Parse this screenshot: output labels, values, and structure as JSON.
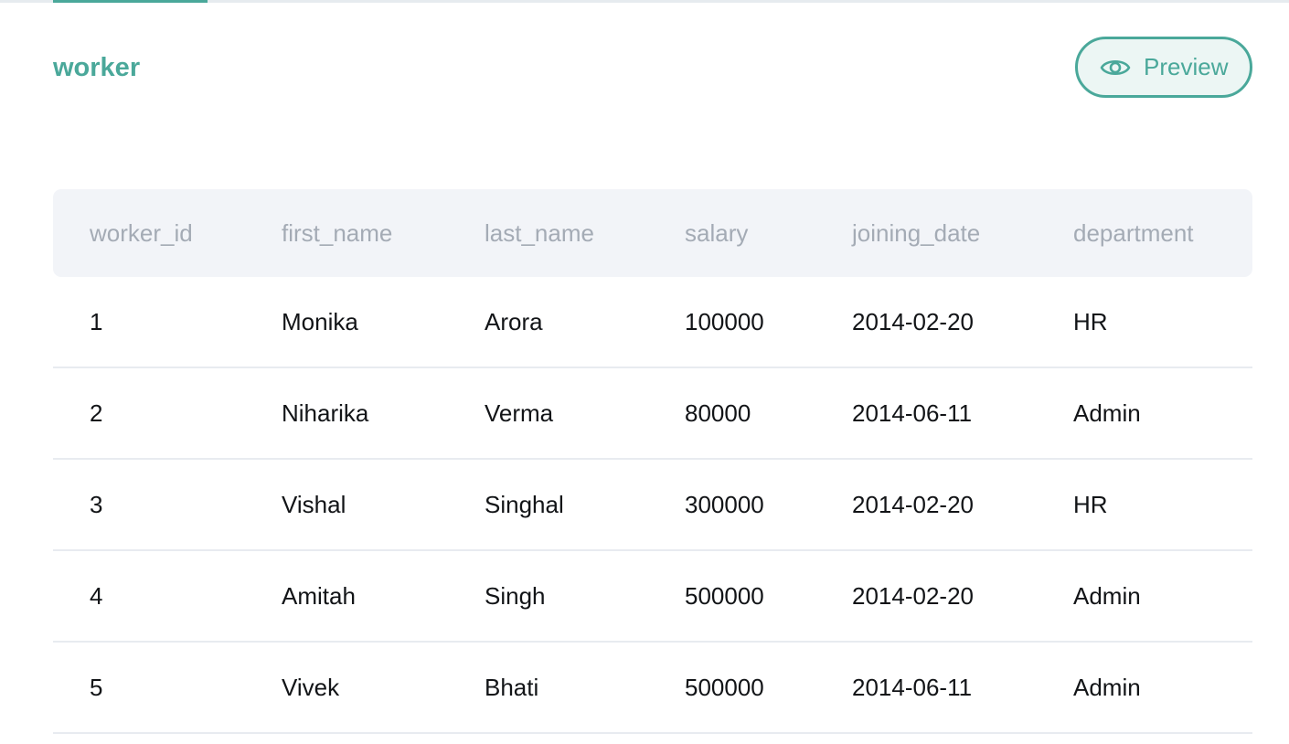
{
  "table": {
    "name": "worker",
    "preview_label": "Preview",
    "columns": [
      "worker_id",
      "first_name",
      "last_name",
      "salary",
      "joining_date",
      "department"
    ],
    "rows": [
      [
        "1",
        "Monika",
        "Arora",
        "100000",
        "2014-02-20",
        "HR"
      ],
      [
        "2",
        "Niharika",
        "Verma",
        "80000",
        "2014-06-11",
        "Admin"
      ],
      [
        "3",
        "Vishal",
        "Singhal",
        "300000",
        "2014-02-20",
        "HR"
      ],
      [
        "4",
        "Amitah",
        "Singh",
        "500000",
        "2014-02-20",
        "Admin"
      ],
      [
        "5",
        "Vivek",
        "Bhati",
        "500000",
        "2014-06-11",
        "Admin"
      ]
    ]
  },
  "icons": {
    "preview": "eye-icon"
  },
  "colors": {
    "accent": "#4aa89a",
    "accent_bg": "#ecf6f4",
    "header_bg": "#f2f4f8",
    "header_text": "#a4abb5",
    "cell_text": "#121417"
  }
}
